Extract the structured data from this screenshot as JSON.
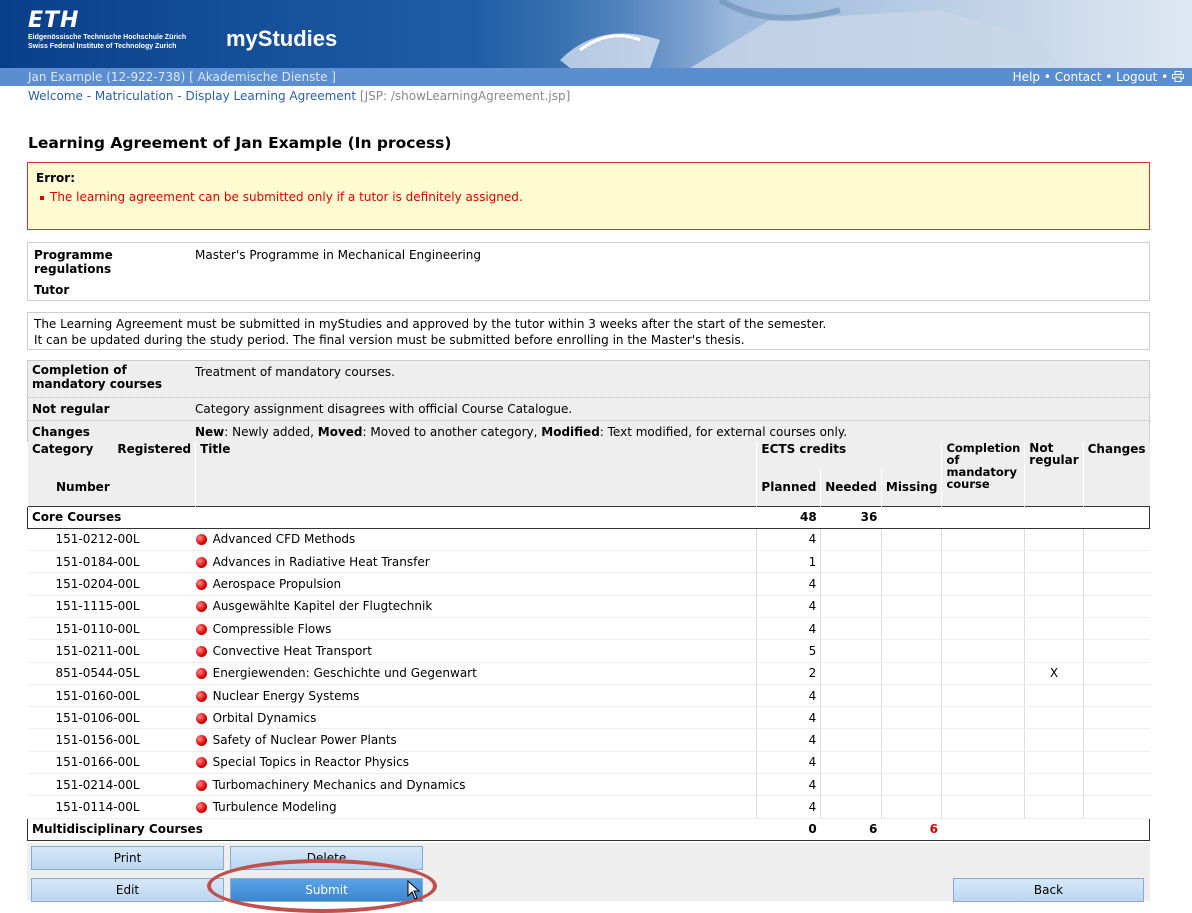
{
  "header": {
    "logo": "ETH",
    "logo_sub1": "Eidgenössische Technische Hochschule Zürich",
    "logo_sub2": "Swiss Federal Institute of Technology Zurich",
    "app_title": "myStudies"
  },
  "userbar": {
    "user": "Jan Example (12-922-738) [ Akademische Dienste ]",
    "help": "Help",
    "contact": "Contact",
    "logout": "Logout",
    "sep": "•",
    "print_icon": "printer-icon"
  },
  "breadcrumb": {
    "welcome": "Welcome",
    "matriculation": "Matriculation",
    "display": "Display Learning Agreement",
    "sep": "-",
    "jsp": "[JSP: /showLearningAgreement.jsp]"
  },
  "page_title": "Learning Agreement of Jan Example (In process)",
  "error": {
    "label": "Error:",
    "message": "The learning agreement can be submitted only if a tutor is definitely assigned."
  },
  "info": {
    "programme_label_1": "Programme",
    "programme_label_2": "regulations",
    "programme_value": "Master's Programme in Mechanical Engineering",
    "tutor_label": "Tutor"
  },
  "note": {
    "line1": "The Learning Agreement must be submitted in myStudies and approved by the tutor within 3 weeks after the start of the semester.",
    "line2": "It can be updated during the study period. The final version must be submitted before enrolling in the Master's thesis."
  },
  "legend": {
    "completion_label_1": "Completion of",
    "completion_label_2": "mandatory courses",
    "completion_value": "Treatment of mandatory courses.",
    "notregular_label": "Not regular",
    "notregular_value": "Category assignment disagrees with official Course Catalogue.",
    "changes_label": "Changes",
    "changes_new": "New",
    "changes_new_text": ": Newly added, ",
    "changes_moved": "Moved",
    "changes_moved_text": ": Moved to another category, ",
    "changes_modified": "Modified",
    "changes_modified_text": ": Text modified, for external courses only."
  },
  "table": {
    "h_category": "Category",
    "h_registered": "Registered",
    "h_title": "Title",
    "h_number": "Number",
    "h_ects": "ECTS credits",
    "h_planned": "Planned",
    "h_needed": "Needed",
    "h_missing": "Missing",
    "h_completion_1": "Completion",
    "h_completion_2": "of",
    "h_completion_3": "mandatory",
    "h_completion_4": "course",
    "h_notregular_1": "Not",
    "h_notregular_2": "regular",
    "h_changes": "Changes",
    "core": {
      "name": "Core Courses",
      "planned": "48",
      "needed": "36",
      "missing": ""
    },
    "courses": [
      {
        "number": "151-0212-00L",
        "title": "Advanced CFD Methods",
        "planned": "4",
        "not_regular": ""
      },
      {
        "number": "151-0184-00L",
        "title": "Advances in Radiative Heat Transfer",
        "planned": "1",
        "not_regular": ""
      },
      {
        "number": "151-0204-00L",
        "title": "Aerospace Propulsion",
        "planned": "4",
        "not_regular": ""
      },
      {
        "number": "151-1115-00L",
        "title": "Ausgewählte Kapitel der Flugtechnik",
        "planned": "4",
        "not_regular": ""
      },
      {
        "number": "151-0110-00L",
        "title": "Compressible Flows",
        "planned": "4",
        "not_regular": ""
      },
      {
        "number": "151-0211-00L",
        "title": "Convective Heat Transport",
        "planned": "5",
        "not_regular": ""
      },
      {
        "number": "851-0544-05L",
        "title": "Energiewenden: Geschichte und Gegenwart",
        "planned": "2",
        "not_regular": "X"
      },
      {
        "number": "151-0160-00L",
        "title": "Nuclear Energy Systems",
        "planned": "4",
        "not_regular": ""
      },
      {
        "number": "151-0106-00L",
        "title": "Orbital Dynamics",
        "planned": "4",
        "not_regular": ""
      },
      {
        "number": "151-0156-00L",
        "title": "Safety of Nuclear Power Plants",
        "planned": "4",
        "not_regular": ""
      },
      {
        "number": "151-0166-00L",
        "title": "Special Topics in Reactor Physics",
        "planned": "4",
        "not_regular": ""
      },
      {
        "number": "151-0214-00L",
        "title": "Turbomachinery Mechanics and Dynamics",
        "planned": "4",
        "not_regular": ""
      },
      {
        "number": "151-0114-00L",
        "title": "Turbulence Modeling",
        "planned": "4",
        "not_regular": ""
      }
    ],
    "multi": {
      "name": "Multidisciplinary Courses",
      "planned": "0",
      "needed": "6",
      "missing": "6"
    }
  },
  "buttons": {
    "print": "Print",
    "delete": "Delete",
    "edit": "Edit",
    "submit": "Submit",
    "back": "Back"
  },
  "colors": {
    "header_blue": "#0a3f8a",
    "userbar": "#5b8ed0",
    "error_red": "#e00000",
    "button": "#b9d6f1",
    "button_active": "#3b86d2",
    "annotation_circle": "#c0504d"
  }
}
